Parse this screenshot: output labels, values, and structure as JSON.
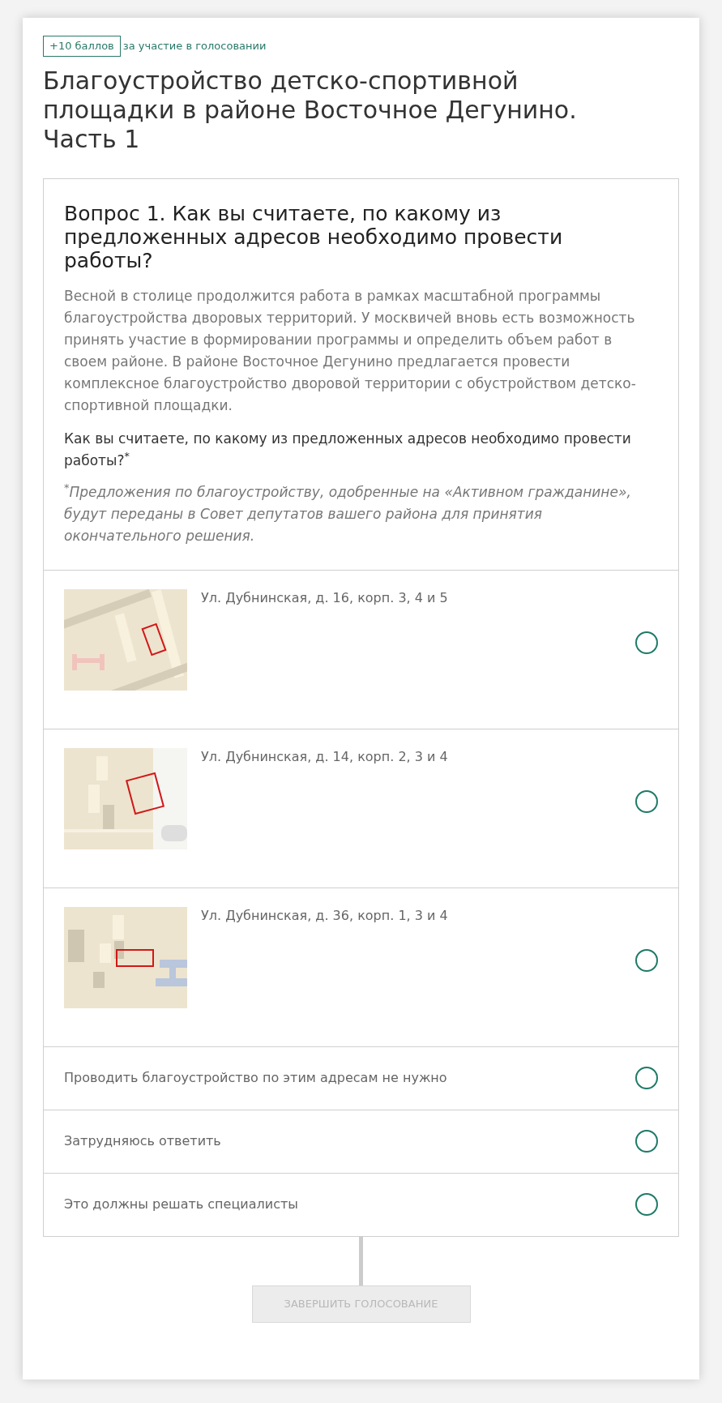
{
  "badge": {
    "points": "+10 баллов",
    "text": "за участие в голосовании"
  },
  "title": "Благоустройство детско-спортивной площадки в районе Восточное Дегунино. Часть 1",
  "question": {
    "heading": "Вопрос 1. Как вы считаете, по какому из предложенных адресов необходимо провести работы?",
    "description": "Весной в столице продолжится работа в рамках масштабной программы благоустройства дворовых территорий. У москвичей вновь есть возможность принять участие в формировании программы и определить объем работ в своем районе. В районе Восточное Дегунино предлагается провести комплексное благоустройство дворовой территории с обустройством детско-спортивной площадки.",
    "prompt": "Как вы считаете, по какому из предложенных адресов необходимо провести работы?$^{*}$",
    "note": "$^{*}$Предложения по благоустройству, одобренные на «Активном гражданине», будут переданы в Совет депутатов вашего района для принятия окончательного решения.",
    "options": [
      {
        "kind": "map",
        "label": "Ул. Дубнинская, д. 16, корп. 3, 4 и 5",
        "selected": false
      },
      {
        "kind": "map",
        "label": "Ул. Дубнинская, д. 14, корп. 2, 3 и 4",
        "selected": false
      },
      {
        "kind": "map",
        "label": "Ул. Дубнинская, д. 36, корп. 1, 3 и 4",
        "selected": false
      },
      {
        "kind": "text",
        "label": "Проводить благоустройство по этим адресам не нужно",
        "selected": false
      },
      {
        "kind": "text",
        "label": "Затрудняюсь ответить",
        "selected": false
      },
      {
        "kind": "text",
        "label": "Это должны решать специалисты",
        "selected": false
      }
    ]
  },
  "submit": {
    "label": "ЗАВЕРШИТЬ ГОЛОСОВАНИЕ",
    "disabled": true
  }
}
